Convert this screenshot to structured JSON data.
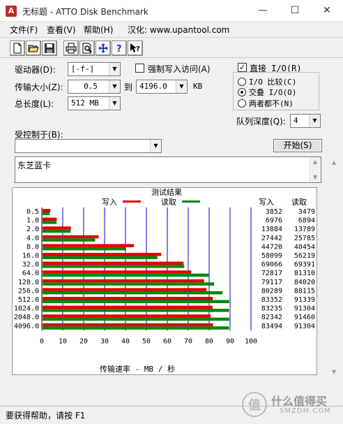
{
  "window": {
    "title": "无标题 - ATTO Disk Benchmark",
    "app_icon": "A",
    "controls": [
      "—",
      "☐",
      "✕"
    ]
  },
  "menu": [
    {
      "label": "文件(F)"
    },
    {
      "label": "查看(V)"
    },
    {
      "label": "帮助(H)"
    },
    {
      "label": "汉化: www.upantool.com"
    }
  ],
  "toolbar_icons": [
    "new-file-icon",
    "open-folder-icon",
    "save-icon",
    "print-icon",
    "print-preview-icon",
    "move-icon",
    "help-icon",
    "context-help-icon"
  ],
  "settings": {
    "drive_label": "驱动器(D):",
    "drive_value": "[-f-]",
    "force_write_label": "强制写入访问(A)",
    "transfer_label": "传输大小(Z):",
    "transfer_from": "0.5",
    "transfer_to_label": "到",
    "transfer_to": "4196.0",
    "transfer_unit": "KB",
    "total_label": "总长度(L):",
    "total_value": "512 MB",
    "direct_io_label": "直接 I/O(R)",
    "direct_io_checked": true,
    "radio_options": [
      "I/O 比较(C)",
      "交叠 I/O(O)",
      "两者都不(N)"
    ],
    "radio_selected": 1,
    "queue_label": "队列深度(Q):",
    "queue_value": "4",
    "controlled_label": "受控制于(B):",
    "controlled_value": "",
    "start_button": "开始(S)",
    "description": "东芝蓝卡"
  },
  "chart_data": {
    "type": "bar",
    "title": "测试结果",
    "orientation": "horizontal",
    "categories": [
      "0.5",
      "1.0",
      "2.0",
      "4.0",
      "8.0",
      "16.0",
      "32.0",
      "64.0",
      "128.0",
      "256.0",
      "512.0",
      "1024.0",
      "2048.0",
      "4096.0"
    ],
    "series": [
      {
        "name": "写入",
        "color": "#e30000",
        "values": [
          3852,
          6976,
          13884,
          27442,
          44720,
          58099,
          69066,
          72817,
          79117,
          80289,
          83352,
          83235,
          82342,
          83494
        ]
      },
      {
        "name": "读取",
        "color": "#00870a",
        "values": [
          3479,
          6894,
          13789,
          25785,
          40454,
          56219,
          69391,
          81310,
          84020,
          88115,
          91339,
          91304,
          91460,
          91304
        ]
      }
    ],
    "col_headers": [
      "写入",
      "读取"
    ],
    "xlabel": "传输速率 - MB / 秒",
    "xticks": [
      "0",
      "10",
      "20",
      "30",
      "40",
      "50",
      "60",
      "70",
      "80",
      "90",
      "100"
    ],
    "xlim": [
      0,
      100
    ],
    "grid_color": "#0000c8",
    "legend_placement": "top-center"
  },
  "status": {
    "text": "要获得帮助，请按 F1"
  },
  "watermark": {
    "text": "什么值得买",
    "sub": "SMZDM.COM"
  }
}
